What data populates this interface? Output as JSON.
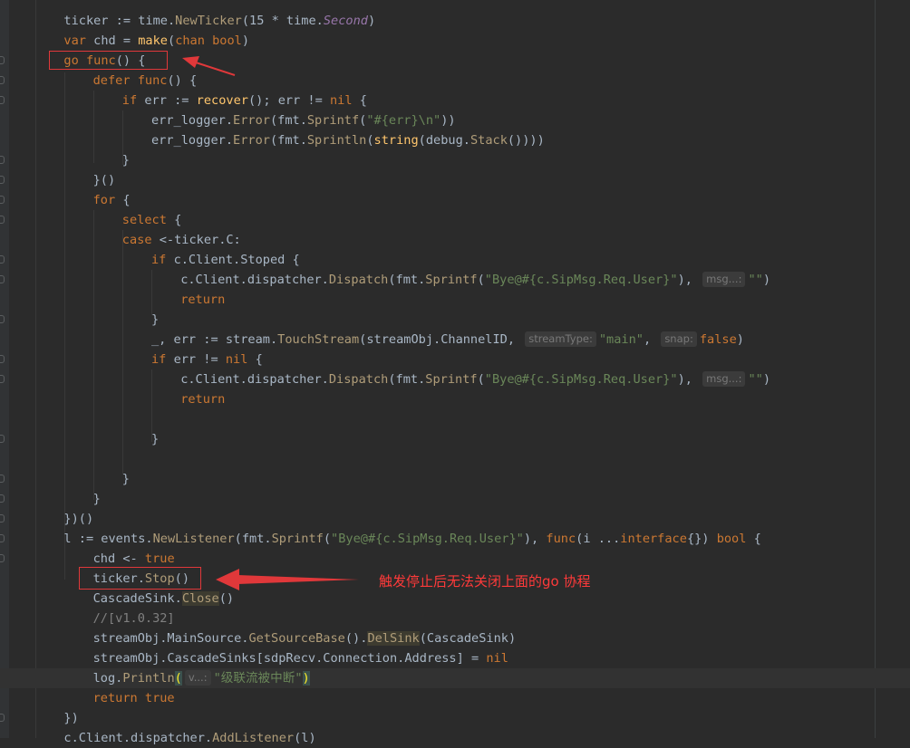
{
  "editor": {
    "lines": [
      [
        [
          "pkg",
          "ticker := "
        ],
        [
          "pkg",
          "time."
        ],
        [
          "call",
          "NewTicker"
        ],
        [
          "pkg",
          "(15 * time."
        ],
        [
          "ital",
          "Second"
        ],
        [
          "pkg",
          ")"
        ]
      ],
      [
        [
          "kw",
          "var "
        ],
        [
          "pkg",
          "chd = "
        ],
        [
          "fn",
          "make"
        ],
        [
          "pkg",
          "("
        ],
        [
          "kw",
          "chan bool"
        ],
        [
          "pkg",
          ")"
        ]
      ],
      [
        [
          "kw",
          "go "
        ],
        [
          "kw",
          "func"
        ],
        [
          "pkg",
          "() {"
        ]
      ],
      [
        [
          "kw",
          "defer "
        ],
        [
          "kw",
          "func"
        ],
        [
          "pkg",
          "() {"
        ]
      ],
      [
        [
          "kw",
          "if "
        ],
        [
          "pkg",
          "err := "
        ],
        [
          "fn",
          "recover"
        ],
        [
          "pkg",
          "(); err != "
        ],
        [
          "kw",
          "nil"
        ],
        [
          "pkg",
          " {"
        ]
      ],
      [
        [
          "pkg",
          "err_logger."
        ],
        [
          "call",
          "Error"
        ],
        [
          "pkg",
          "(fmt."
        ],
        [
          "call",
          "Sprintf"
        ],
        [
          "pkg",
          "("
        ],
        [
          "str",
          "\"#{err}\\n\""
        ],
        [
          "pkg",
          "))"
        ]
      ],
      [
        [
          "pkg",
          "err_logger."
        ],
        [
          "call",
          "Error"
        ],
        [
          "pkg",
          "(fmt."
        ],
        [
          "call",
          "Sprintln"
        ],
        [
          "pkg",
          "("
        ],
        [
          "fn",
          "string"
        ],
        [
          "pkg",
          "(debug."
        ],
        [
          "call",
          "Stack"
        ],
        [
          "pkg",
          "())))"
        ]
      ],
      [
        [
          "pkg",
          "}"
        ]
      ],
      [
        [
          "pkg",
          "}()"
        ]
      ],
      [
        [
          "kw",
          "for "
        ],
        [
          "pkg",
          "{"
        ]
      ],
      [
        [
          "kw",
          "select "
        ],
        [
          "pkg",
          "{"
        ]
      ],
      [
        [
          "kw",
          "case "
        ],
        [
          "pkg",
          "<-ticker.C:"
        ]
      ],
      [
        [
          "kw",
          "if "
        ],
        [
          "pkg",
          "c.Client.Stoped {"
        ]
      ],
      [
        [
          "pkg",
          "c.Client.dispatcher."
        ],
        [
          "call",
          "Dispatch"
        ],
        [
          "pkg",
          "(fmt."
        ],
        [
          "call",
          "Sprintf"
        ],
        [
          "pkg",
          "("
        ],
        [
          "str",
          "\"Bye@#{c.SipMsg.Req.User}\""
        ],
        [
          "pkg",
          "), "
        ],
        [
          "hint",
          "msg...:"
        ],
        [
          "str",
          "\"\""
        ],
        [
          "pkg",
          ")"
        ]
      ],
      [
        [
          "kw",
          "return"
        ]
      ],
      [
        [
          "pkg",
          "}"
        ]
      ],
      [
        [
          "pkg",
          "_, err := stream."
        ],
        [
          "call",
          "TouchStream"
        ],
        [
          "pkg",
          "(streamObj.ChannelID, "
        ],
        [
          "hint",
          "streamType:"
        ],
        [
          "str",
          "\"main\""
        ],
        [
          "pkg",
          ", "
        ],
        [
          "hint",
          "snap:"
        ],
        [
          "kw",
          "false"
        ],
        [
          "pkg",
          ")"
        ]
      ],
      [
        [
          "kw",
          "if "
        ],
        [
          "pkg",
          "err != "
        ],
        [
          "kw",
          "nil"
        ],
        [
          "pkg",
          " {"
        ]
      ],
      [
        [
          "pkg",
          "c.Client.dispatcher."
        ],
        [
          "call",
          "Dispatch"
        ],
        [
          "pkg",
          "(fmt."
        ],
        [
          "call",
          "Sprintf"
        ],
        [
          "pkg",
          "("
        ],
        [
          "str",
          "\"Bye@#{c.SipMsg.Req.User}\""
        ],
        [
          "pkg",
          "), "
        ],
        [
          "hint",
          "msg...:"
        ],
        [
          "str",
          "\"\""
        ],
        [
          "pkg",
          ")"
        ]
      ],
      [
        [
          "kw",
          "return"
        ]
      ],
      [],
      [
        [
          "pkg",
          "}"
        ]
      ],
      [],
      [
        [
          "pkg",
          "}"
        ]
      ],
      [
        [
          "pkg",
          "}"
        ]
      ],
      [
        [
          "pkg",
          "})()"
        ]
      ],
      [
        [
          "pkg",
          "l := events."
        ],
        [
          "call",
          "NewListener"
        ],
        [
          "pkg",
          "(fmt."
        ],
        [
          "call",
          "Sprintf"
        ],
        [
          "pkg",
          "("
        ],
        [
          "str",
          "\"Bye@#{c.SipMsg.Req.User}\""
        ],
        [
          "pkg",
          "), "
        ],
        [
          "kw",
          "func"
        ],
        [
          "pkg",
          "(i ..."
        ],
        [
          "kw",
          "interface"
        ],
        [
          "pkg",
          "{}) "
        ],
        [
          "kw",
          "bool"
        ],
        [
          "pkg",
          " {"
        ]
      ],
      [
        [
          "pkg",
          "chd <- "
        ],
        [
          "kw",
          "true"
        ]
      ],
      [
        [
          "pkg",
          "ticker."
        ],
        [
          "call",
          "Stop"
        ],
        [
          "pkg",
          "()"
        ]
      ],
      [
        [
          "pkg",
          "CascadeSink."
        ],
        [
          "hl",
          "Close"
        ],
        [
          "pkg",
          "()"
        ]
      ],
      [
        [
          "cmt",
          "//[v1.0.32]"
        ]
      ],
      [
        [
          "pkg",
          "streamObj.MainSource."
        ],
        [
          "call",
          "GetSourceBase"
        ],
        [
          "pkg",
          "()."
        ],
        [
          "hl",
          "DelSink"
        ],
        [
          "pkg",
          "(CascadeSink)"
        ]
      ],
      [
        [
          "pkg",
          "streamObj.CascadeSinks[sdpRecv.Connection.Address] = "
        ],
        [
          "kw",
          "nil"
        ]
      ],
      [
        [
          "pkg",
          "log."
        ],
        [
          "call",
          "Println"
        ],
        [
          "bm",
          "("
        ],
        [
          "hint",
          "v...:"
        ],
        [
          "str",
          "\"级联流被中断\""
        ],
        [
          "bm",
          ")"
        ]
      ],
      [
        [
          "kw",
          "return true"
        ]
      ],
      [
        [
          "pkg",
          "})"
        ]
      ],
      [
        [
          "pkg",
          "c.Client.dispatcher."
        ],
        [
          "call",
          "AddListener"
        ],
        [
          "pkg",
          "(l)"
        ]
      ]
    ]
  },
  "annotation": {
    "text": "触发停止后无法关闭上面的go 协程"
  },
  "colors": {
    "background": "#2b2b2b",
    "keyword": "#cc7832",
    "string": "#6a8759",
    "function": "#ffc66d",
    "annotation": "#ff3a3a"
  }
}
